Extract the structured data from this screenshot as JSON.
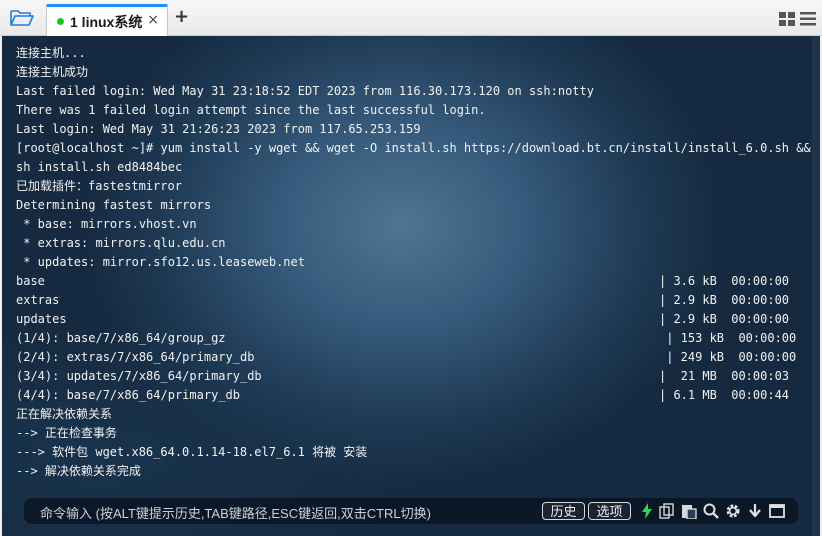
{
  "tab": {
    "title": "1 linux系统",
    "close": "×",
    "add": "+"
  },
  "terminal": {
    "lines": [
      "连接主机...",
      "连接主机成功",
      "Last failed login: Wed May 31 23:18:52 EDT 2023 from 116.30.173.120 on ssh:notty",
      "There was 1 failed login attempt since the last successful login.",
      "Last login: Wed May 31 21:26:23 2023 from 117.65.253.159",
      "[root@localhost ~]# yum install -y wget && wget -O install.sh https://download.bt.cn/install/install_6.0.sh &&",
      "sh install.sh ed8484bec",
      "已加载插件：fastestmirror",
      "Determining fastest mirrors",
      " * base: mirrors.vhost.vn",
      " * extras: mirrors.qlu.edu.cn",
      " * updates: mirror.sfo12.us.leaseweb.net",
      "base                                                                                     | 3.6 kB  00:00:00",
      "extras                                                                                   | 2.9 kB  00:00:00",
      "updates                                                                                  | 2.9 kB  00:00:00",
      "(1/4): base/7/x86_64/group_gz                                                             | 153 kB  00:00:00",
      "(2/4): extras/7/x86_64/primary_db                                                         | 249 kB  00:00:00",
      "(3/4): updates/7/x86_64/primary_db                                                       |  21 MB  00:00:03",
      "(4/4): base/7/x86_64/primary_db                                                          | 6.1 MB  00:00:44",
      "正在解决依赖关系",
      "--> 正在检查事务",
      "---> 软件包 wget.x86_64.0.1.14-18.el7_6.1 将被 安装",
      "--> 解决依赖关系完成"
    ]
  },
  "input": {
    "placeholder": "命令输入 (按ALT键提示历史,TAB键路径,ESC键返回,双击CTRL切换)",
    "history_label": "历史",
    "options_label": "选项"
  },
  "icons": [
    "folder-open-icon",
    "grid-icon",
    "menu-icon",
    "flash-icon",
    "copy-icon",
    "paste-icon",
    "search-icon",
    "gear-icon",
    "download-icon",
    "window-icon"
  ],
  "colors": {
    "tab_accent": "#1e90ff",
    "status_dot": "#21c021",
    "flash": "#32d74b"
  }
}
